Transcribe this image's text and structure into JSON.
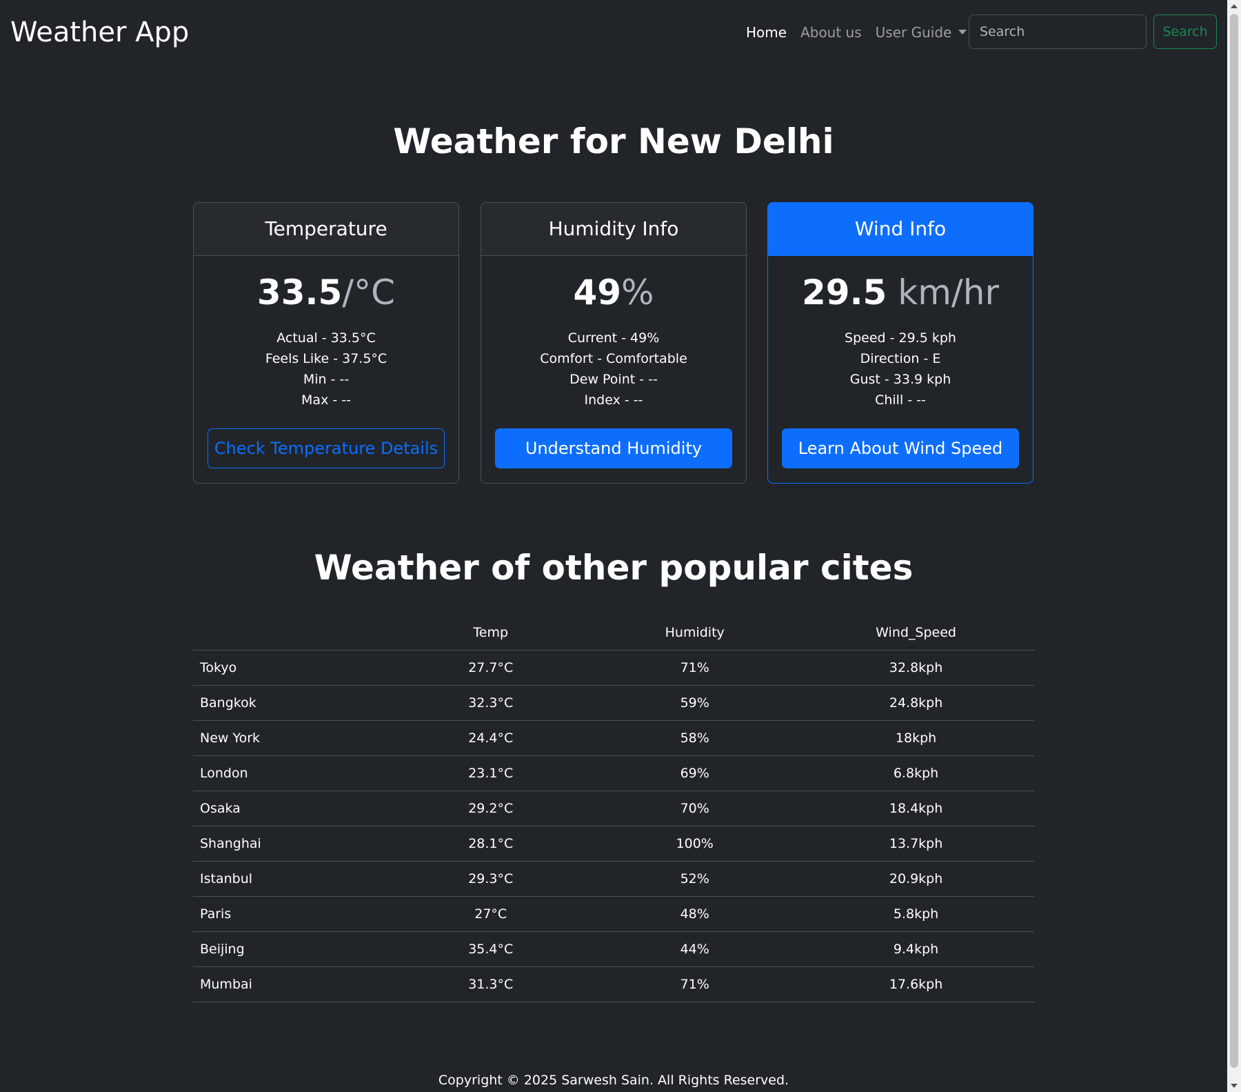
{
  "navbar": {
    "brand": "Weather App",
    "links": [
      "Home",
      "About us",
      "User Guide"
    ],
    "search_placeholder": "Search",
    "search_button": "Search"
  },
  "main": {
    "title": "Weather for New Delhi"
  },
  "cards": {
    "temperature": {
      "header": "Temperature",
      "value": "33.5",
      "unit": "/°C",
      "lines": [
        "Actual - 33.5°C",
        "Feels Like - 37.5°C",
        "Min - --",
        "Max - --"
      ],
      "button": "Check Temperature Details"
    },
    "humidity": {
      "header": "Humidity Info",
      "value": "49",
      "unit": "%",
      "lines": [
        "Current - 49%",
        "Comfort - Comfortable",
        "Dew Point - --",
        "Index - --"
      ],
      "button": "Understand Humidity"
    },
    "wind": {
      "header": "Wind Info",
      "value": "29.5",
      "unit": " km/hr",
      "lines": [
        "Speed - 29.5 kph",
        "Direction - E",
        "Gust - 33.9 kph",
        "Chill - --"
      ],
      "button": "Learn About Wind Speed"
    }
  },
  "popular": {
    "title": "Weather of other popular cites",
    "columns": [
      "",
      "Temp",
      "Humidity",
      "Wind_Speed"
    ],
    "rows": [
      [
        "Tokyo",
        "27.7°C",
        "71%",
        "32.8kph"
      ],
      [
        "Bangkok",
        "32.3°C",
        "59%",
        "24.8kph"
      ],
      [
        "New York",
        "24.4°C",
        "58%",
        "18kph"
      ],
      [
        "London",
        "23.1°C",
        "69%",
        "6.8kph"
      ],
      [
        "Osaka",
        "29.2°C",
        "70%",
        "18.4kph"
      ],
      [
        "Shanghai",
        "28.1°C",
        "100%",
        "13.7kph"
      ],
      [
        "Istanbul",
        "29.3°C",
        "52%",
        "20.9kph"
      ],
      [
        "Paris",
        "27°C",
        "48%",
        "5.8kph"
      ],
      [
        "Beijing",
        "35.4°C",
        "44%",
        "9.4kph"
      ],
      [
        "Mumbai",
        "31.3°C",
        "71%",
        "17.6kph"
      ]
    ]
  },
  "footer": {
    "text": "Copyright © 2025 Sarwesh Sain. All Rights Reserved."
  },
  "colors": {
    "background": "#212529",
    "primary": "#0d6efd",
    "success": "#198754",
    "border": "#495057"
  },
  "icons": {
    "dropdown": "caret-down-icon"
  }
}
